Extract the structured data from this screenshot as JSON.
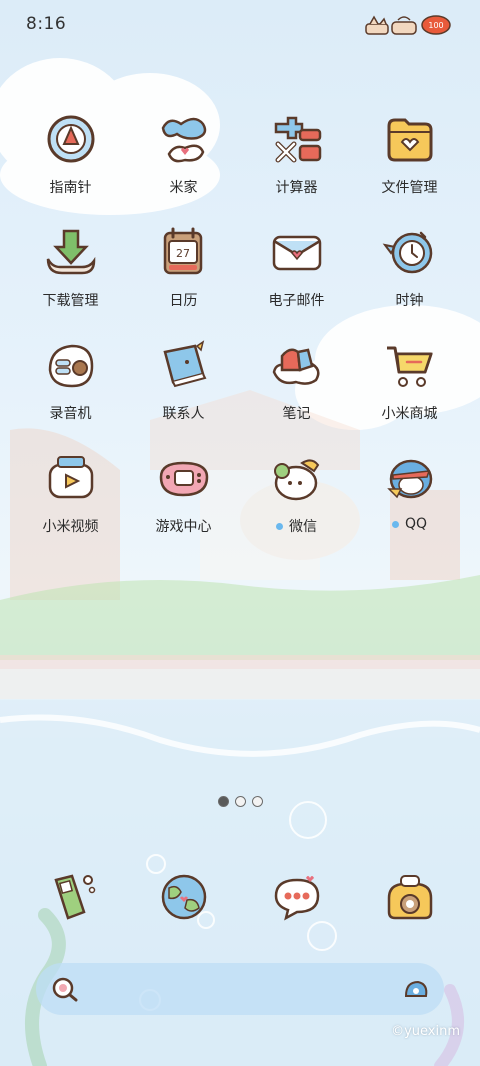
{
  "status_bar": {
    "time": "8:16"
  },
  "apps": [
    {
      "label": "指南针",
      "icon": "compass-icon"
    },
    {
      "label": "米家",
      "icon": "mi-home-icon"
    },
    {
      "label": "计算器",
      "icon": "calculator-icon"
    },
    {
      "label": "文件管理",
      "icon": "file-manager-icon"
    },
    {
      "label": "下载管理",
      "icon": "download-icon"
    },
    {
      "label": "日历",
      "icon": "calendar-icon",
      "calendar_day": "27"
    },
    {
      "label": "电子邮件",
      "icon": "mail-icon"
    },
    {
      "label": "时钟",
      "icon": "clock-icon"
    },
    {
      "label": "录音机",
      "icon": "recorder-icon"
    },
    {
      "label": "联系人",
      "icon": "contacts-icon"
    },
    {
      "label": "笔记",
      "icon": "notes-icon"
    },
    {
      "label": "小米商城",
      "icon": "mi-store-icon"
    },
    {
      "label": "小米视频",
      "icon": "video-icon"
    },
    {
      "label": "游戏中心",
      "icon": "game-center-icon"
    },
    {
      "label": "微信",
      "icon": "wechat-icon",
      "new_badge": true
    },
    {
      "label": "QQ",
      "icon": "qq-icon",
      "new_badge": true
    }
  ],
  "pager": {
    "pages": 3,
    "active": 0
  },
  "dock": [
    {
      "name": "phone",
      "icon": "phone-icon"
    },
    {
      "name": "browser",
      "icon": "globe-icon"
    },
    {
      "name": "messages",
      "icon": "chat-bubble-icon"
    },
    {
      "name": "camera",
      "icon": "camera-icon"
    }
  ],
  "search": {
    "left_icon": "search-icon",
    "right_icon": "assistant-icon"
  },
  "watermark": "©yuexinm",
  "colors": {
    "accent_dot": "#6ab8ee",
    "background": "#e6f2fb",
    "icon_outline": "#5a3a2a"
  }
}
